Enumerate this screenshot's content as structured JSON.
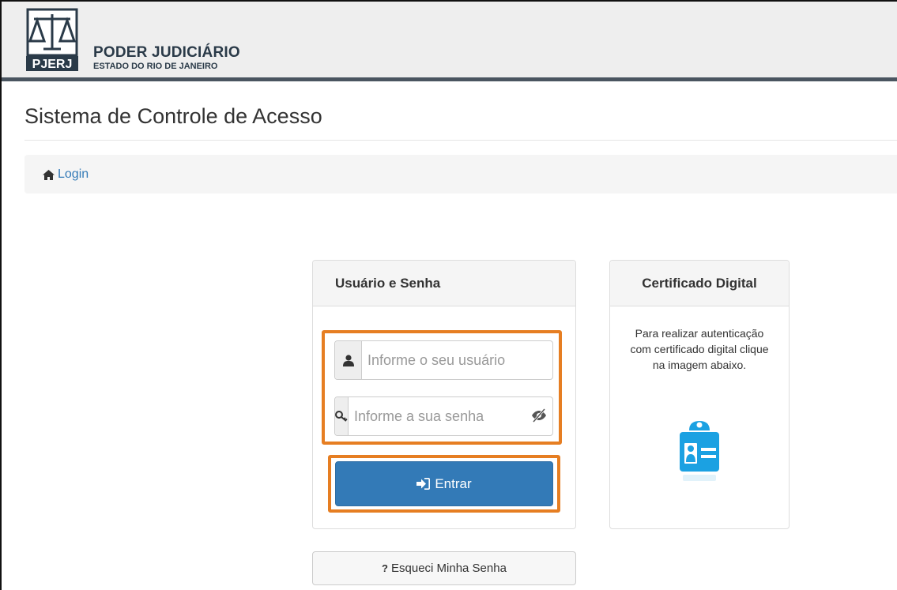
{
  "header": {
    "logo_text": "PJERJ",
    "title": "PODER JUDICIÁRIO",
    "subtitle": "ESTADO DO RIO DE JANEIRO"
  },
  "page": {
    "title": "Sistema de Controle de Acesso"
  },
  "breadcrumb": {
    "login_label": "Login",
    "icon": "home-icon"
  },
  "login_panel": {
    "heading": "Usuário e Senha",
    "username": {
      "placeholder": "Informe o seu usuário",
      "value": "",
      "icon": "user-icon"
    },
    "password": {
      "placeholder": "Informe a sua senha",
      "value": "",
      "icon": "key-icon",
      "toggle_icon": "eye-slash-icon"
    },
    "submit_label": "Entrar",
    "submit_icon": "sign-in-icon"
  },
  "certificate_panel": {
    "heading": "Certificado Digital",
    "description": "Para realizar autenticação com certificado digital clique na imagem abaixo.",
    "icon": "id-card-icon"
  },
  "forgot": {
    "label": "Esqueci Minha Senha",
    "icon": "question-icon"
  },
  "colors": {
    "primary": "#337ab7",
    "highlight": "#e67e22",
    "header_bar": "#4a5560",
    "cert_icon": "#1ba1e2"
  }
}
